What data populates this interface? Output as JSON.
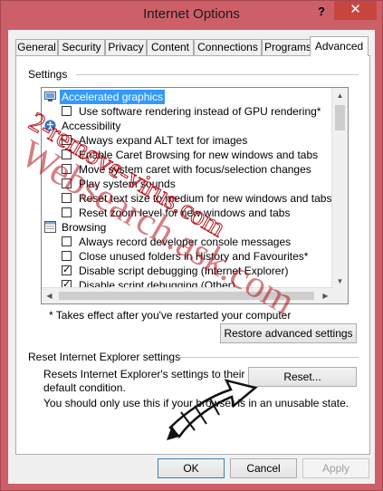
{
  "window": {
    "title": "Internet Options",
    "help_label": "?",
    "close_label": "✕"
  },
  "tabs": [
    {
      "label": "General"
    },
    {
      "label": "Security"
    },
    {
      "label": "Privacy"
    },
    {
      "label": "Content"
    },
    {
      "label": "Connections"
    },
    {
      "label": "Programs"
    },
    {
      "label": "Advanced",
      "active": true
    }
  ],
  "settings": {
    "group_label": "Settings",
    "items": [
      {
        "type": "category",
        "label": "Accelerated graphics",
        "icon": "monitor-icon",
        "selected": true
      },
      {
        "type": "checkbox",
        "label": "Use software rendering instead of GPU rendering*",
        "checked": false
      },
      {
        "type": "category",
        "label": "Accessibility",
        "icon": "accessibility-icon"
      },
      {
        "type": "checkbox",
        "label": "Always expand ALT text for images",
        "checked": false
      },
      {
        "type": "checkbox",
        "label": "Enable Caret Browsing for new windows and tabs",
        "checked": false
      },
      {
        "type": "checkbox",
        "label": "Move system caret with focus/selection changes",
        "checked": false
      },
      {
        "type": "checkbox",
        "label": "Play system sounds",
        "checked": false
      },
      {
        "type": "checkbox",
        "label": "Reset text size to medium for new windows and tabs",
        "checked": false
      },
      {
        "type": "checkbox",
        "label": "Reset zoom level for new windows and tabs",
        "checked": false
      },
      {
        "type": "category",
        "label": "Browsing",
        "icon": "browsing-icon"
      },
      {
        "type": "checkbox",
        "label": "Always record developer console messages",
        "checked": false
      },
      {
        "type": "checkbox",
        "label": "Close unused folders in History and Favourites*",
        "checked": false
      },
      {
        "type": "checkbox",
        "label": "Disable script debugging (Internet Explorer)",
        "checked": true
      },
      {
        "type": "checkbox",
        "label": "Disable script debugging (Other)",
        "checked": true
      }
    ],
    "restart_note": "* Takes effect after you've restarted your computer",
    "restore_button": "Restore advanced settings"
  },
  "reset": {
    "group_label": "Reset Internet Explorer settings",
    "description": "Resets Internet Explorer's settings to their default condition.",
    "reset_button": "Reset...",
    "warning": "You should only use this if your browser is in an unusable state."
  },
  "footer": {
    "ok": "OK",
    "cancel": "Cancel",
    "apply": "Apply"
  },
  "watermark": {
    "line1": "2-remove-virus.com",
    "line2": "Websearch.ask.com"
  },
  "colors": {
    "frame": "#cd5f68",
    "selection": "#3399ff",
    "close_button": "#c7463f",
    "watermark": "#b3121c"
  }
}
